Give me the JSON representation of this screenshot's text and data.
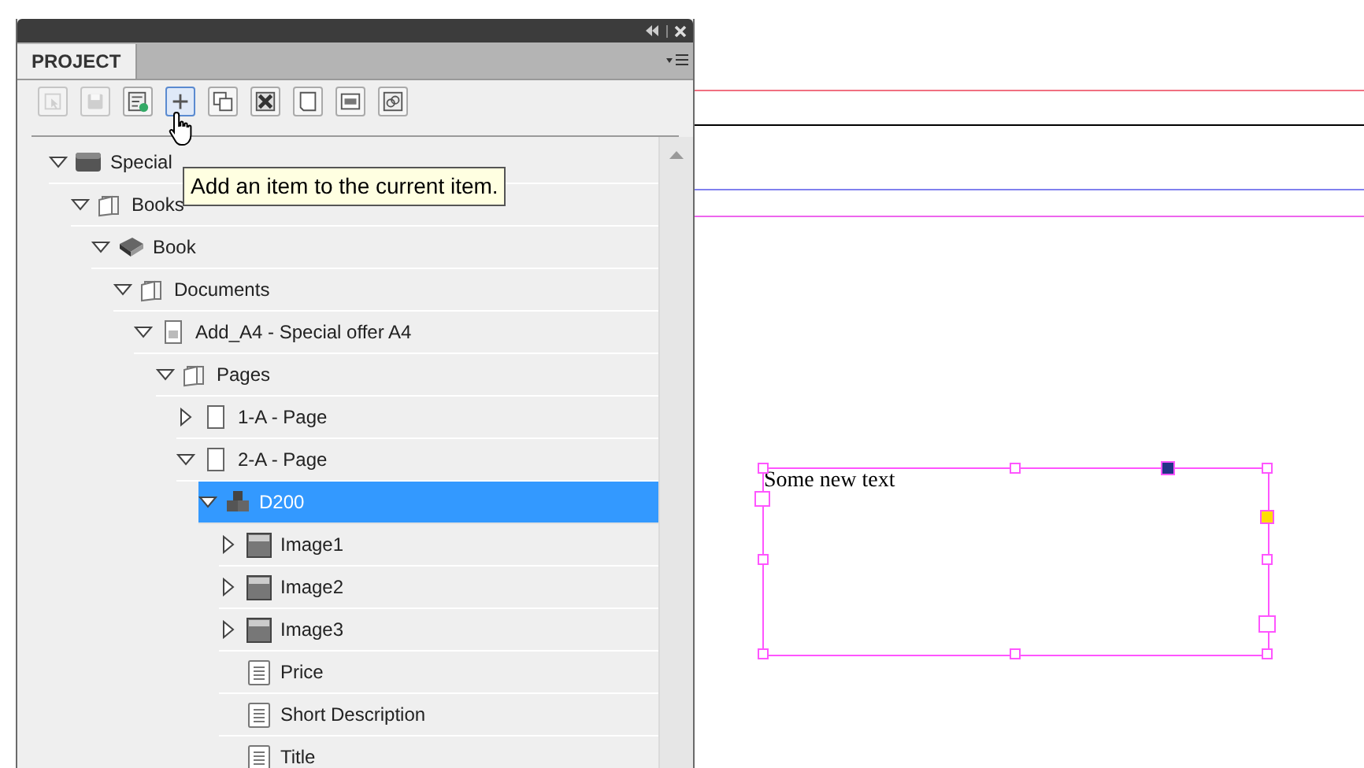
{
  "panel": {
    "tabs": [
      {
        "label": "PROJECT",
        "selected": true
      }
    ]
  },
  "toolbar": [
    {
      "kind": "select",
      "disabled": true,
      "hovered": false
    },
    {
      "kind": "save",
      "disabled": true,
      "hovered": false
    },
    {
      "kind": "properties",
      "disabled": false,
      "hovered": false
    },
    {
      "kind": "add",
      "disabled": false,
      "hovered": true
    },
    {
      "kind": "duplicate",
      "disabled": false,
      "hovered": false
    },
    {
      "kind": "delete",
      "disabled": false,
      "hovered": false
    },
    {
      "kind": "page",
      "disabled": false,
      "hovered": false
    },
    {
      "kind": "frame",
      "disabled": false,
      "hovered": false
    },
    {
      "kind": "link",
      "disabled": false,
      "hovered": false
    }
  ],
  "tooltip": "Add an item to the current item.",
  "tree": [
    {
      "label": "Special",
      "kind": "project",
      "expanded": true,
      "selected": false,
      "children": [
        {
          "label": "Books",
          "kind": "folder",
          "expanded": true,
          "selected": false,
          "children": [
            {
              "label": "Book",
              "kind": "book",
              "expanded": true,
              "selected": false,
              "children": [
                {
                  "label": "Documents",
                  "kind": "folder",
                  "expanded": true,
                  "selected": false,
                  "children": [
                    {
                      "label": "Add_A4 - Special offer A4",
                      "kind": "document",
                      "expanded": true,
                      "selected": false,
                      "children": [
                        {
                          "label": "Pages",
                          "kind": "folder",
                          "expanded": true,
                          "selected": false,
                          "children": [
                            {
                              "label": "1-A - Page",
                              "kind": "page",
                              "expanded": false,
                              "selected": false
                            },
                            {
                              "label": "2-A - Page",
                              "kind": "page",
                              "expanded": true,
                              "selected": false,
                              "children": [
                                {
                                  "label": "D200",
                                  "kind": "group",
                                  "expanded": true,
                                  "selected": true,
                                  "children": [
                                    {
                                      "label": "Image1",
                                      "kind": "image",
                                      "expanded": false,
                                      "selected": false
                                    },
                                    {
                                      "label": "Image2",
                                      "kind": "image",
                                      "expanded": false,
                                      "selected": false
                                    },
                                    {
                                      "label": "Image3",
                                      "kind": "image",
                                      "expanded": false,
                                      "selected": false
                                    },
                                    {
                                      "label": "Price",
                                      "kind": "text",
                                      "selected": false
                                    },
                                    {
                                      "label": "Short Description",
                                      "kind": "text",
                                      "selected": false
                                    },
                                    {
                                      "label": "Title",
                                      "kind": "text",
                                      "selected": false
                                    }
                                  ]
                                }
                              ]
                            }
                          ]
                        }
                      ]
                    }
                  ]
                }
              ]
            }
          ]
        }
      ]
    }
  ],
  "canvas": {
    "guides": [
      {
        "color": "#f07080"
      },
      {
        "color": "#000000"
      },
      {
        "color": "#8080ee"
      },
      {
        "color": "#ee66ee"
      }
    ],
    "text_frame": {
      "text": "Some new text"
    }
  }
}
